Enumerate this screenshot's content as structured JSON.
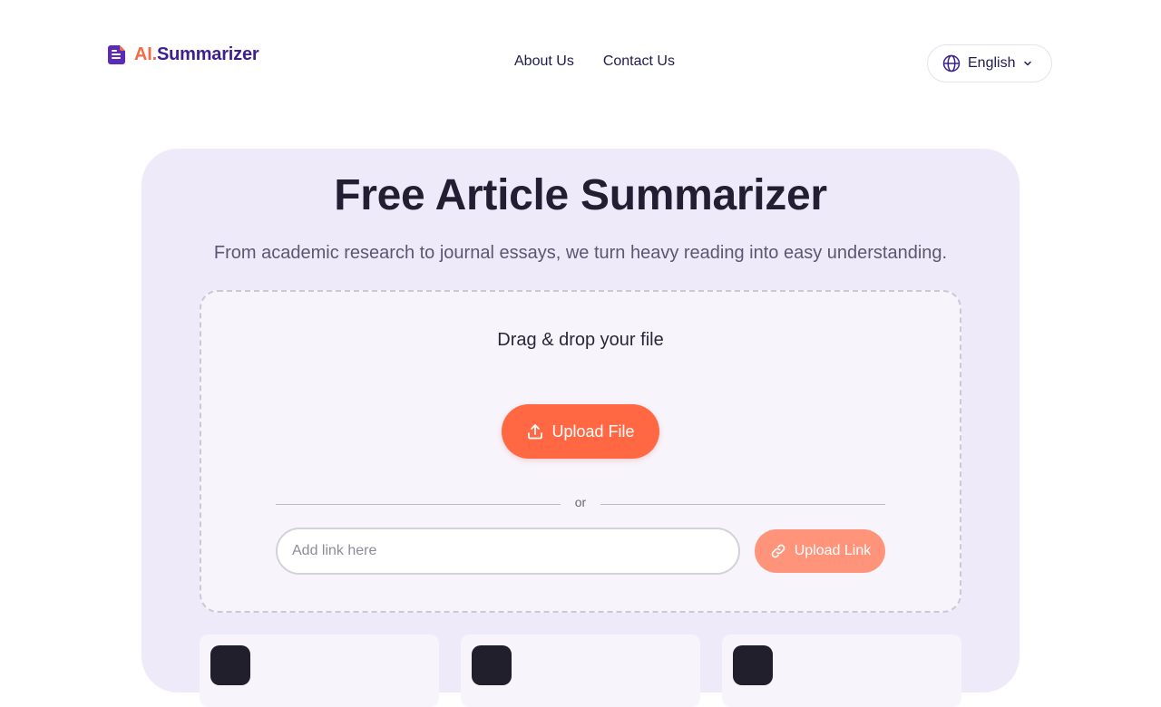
{
  "brand": {
    "prefix": "AI.",
    "name": "Summarizer"
  },
  "nav": {
    "about": "About Us",
    "contact": "Contact Us"
  },
  "language": {
    "selected": "English"
  },
  "hero": {
    "title": "Free Article Summarizer",
    "subtitle": "From academic research to journal essays, we turn heavy reading into easy understanding."
  },
  "upload": {
    "drop_text": "Drag & drop your file",
    "upload_file_label": "Upload File",
    "or_label": "or",
    "link_placeholder": "Add link here",
    "link_value": "",
    "upload_link_label": "Upload Link"
  },
  "icons": {
    "logo": "document-icon",
    "language": "globe-icon",
    "dropdown": "chevron-down-icon",
    "upload": "upload-icon",
    "link": "link-icon"
  },
  "colors": {
    "accent": "#ff6843",
    "brand_orange": "#f26b47",
    "brand_purple": "#3d1f8f",
    "hero_bg": "#efeafa"
  }
}
